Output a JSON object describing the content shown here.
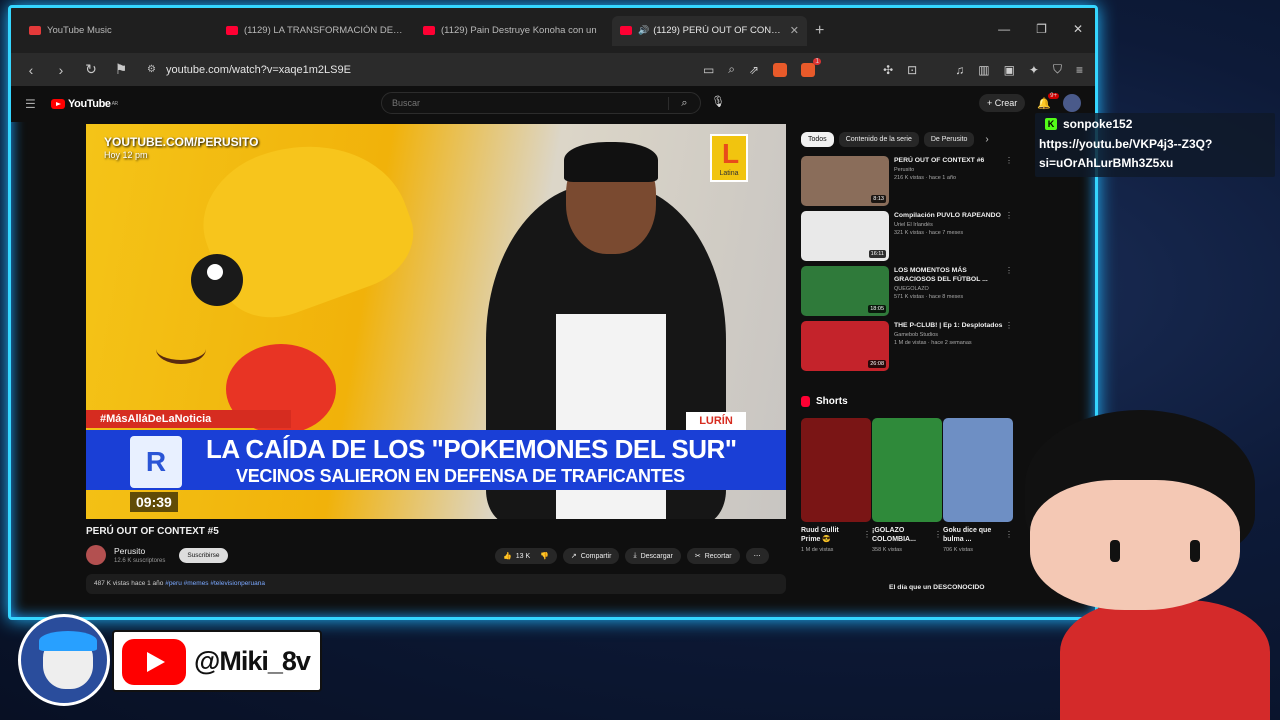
{
  "browser": {
    "tabs": [
      {
        "title": "YouTube Music",
        "active": false
      },
      {
        "title": "(1129) LA TRANSFORMACIÓN DEFIN",
        "active": false
      },
      {
        "title": "(1129) Pain Destruye Konoha con un",
        "active": false
      },
      {
        "title": "(1129) PERÚ OUT OF CONTEXT",
        "active": true
      }
    ],
    "url": "youtube.com/watch?v=xaqe1m2LS9E"
  },
  "youtube": {
    "logo_text": "YouTube",
    "logo_country": "AR",
    "search_placeholder": "Buscar",
    "create_label": "Crear",
    "notif_count": "9+"
  },
  "player": {
    "watermark": "YOUTUBE.COM/PERUSITO",
    "watermark_sub": "Hoy 12 pm",
    "network": "Latina",
    "hashtag_bar": "#MásAlláDeLaNoticia",
    "location": "LURÍN",
    "logo_letters": "R",
    "headline": "LA CAÍDA DE LOS \"POKEMONES DEL SUR\"",
    "subheadline": "VECINOS SALIERON EN DEFENSA DE TRAFICANTES",
    "timestamp": "09:39"
  },
  "video": {
    "title": "PERÚ OUT OF CONTEXT #5",
    "channel": "Perusito",
    "subscribers": "12.6 K suscriptores",
    "subscribe_label": "Suscribirse",
    "likes": "13 K",
    "share_label": "Compartir",
    "download_label": "Descargar",
    "clip_label": "Recortar",
    "meta": "487 K vistas  hace 1 año",
    "tags": "#peru #memes #televisionperuana"
  },
  "sidebar": {
    "chips": [
      "Todos",
      "Contenido de la serie",
      "De Perusito"
    ],
    "recommendations": [
      {
        "title": "PERÚ OUT OF CONTEXT #6",
        "channel": "Perusito",
        "meta": "216 K vistas · hace 1 año",
        "duration": "8:13",
        "color": "#8a6d5a"
      },
      {
        "title": "Compilación PUVLO RAPEANDO",
        "channel": "Uriel El Irlandés",
        "meta": "321 K vistas · hace 7 meses",
        "duration": "16:11",
        "color": "#e9e9e9"
      },
      {
        "title": "LOS MOMENTOS MÁS GRACIOSOS DEL FÚTBOL ...",
        "channel": "QUEGOLAZO",
        "meta": "571 K vistas · hace 8 meses",
        "duration": "18:05",
        "color": "#2f7a3a"
      },
      {
        "title": "THE P-CLUB! | Ep 1: Desplotados",
        "channel": "Gamebob Studios",
        "meta": "1 M de vistas · hace 2 semanas",
        "duration": "26:08",
        "color": "#c4232b"
      }
    ],
    "shorts_label": "Shorts",
    "shorts": [
      {
        "title": "Ruud Gullit Prime 😎",
        "views": "1 M de vistas",
        "color": "#7a1515"
      },
      {
        "title": "¡GOLAZO COLOMBIA...",
        "views": "358 K vistas",
        "color": "#2f8a3a"
      },
      {
        "title": "Goku dice que bulma ...",
        "views": "706 K vistas",
        "color": "#6e8fc4"
      }
    ],
    "next_title": "El día que un DESCONOCIDO"
  },
  "overlay": {
    "chat_user": "sonpoke152",
    "chat_message": "https://youtu.be/VKP4j3--Z3Q?si=uOrAhLurBMh3Z5xu",
    "social_handle": "@Miki_8v"
  },
  "colors": {
    "neon": "#35d6ff",
    "yt_red": "#ff0000",
    "banner_blue": "#1a3fd6",
    "kick_green": "#53fc18"
  }
}
